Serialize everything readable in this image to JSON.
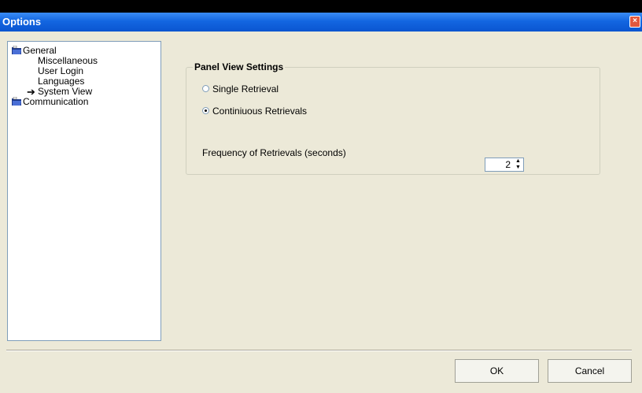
{
  "window": {
    "title": "Options",
    "close_label": "×"
  },
  "tree": [
    {
      "label": "General",
      "icon": "folder-icon"
    },
    {
      "label": "Miscellaneous"
    },
    {
      "label": "User Login"
    },
    {
      "label": "Languages"
    },
    {
      "label": "System View",
      "selected_marker": "arrow-icon",
      "arrow": "➔"
    },
    {
      "label": "Communication",
      "icon": "folder-icon"
    }
  ],
  "panel": {
    "legend": "Panel View Settings",
    "options": [
      {
        "label": "Single Retrieval",
        "checked": false
      },
      {
        "label": "Continiuous Retrievals",
        "checked": true
      }
    ],
    "frequency_label": "Frequency of Retrievals (seconds)",
    "frequency_value": "2"
  },
  "buttons": {
    "ok": "OK",
    "cancel": "Cancel"
  },
  "colors": {
    "titlebar": "#1366e1",
    "window_bg": "#ece9d8",
    "close": "#e2583e"
  }
}
